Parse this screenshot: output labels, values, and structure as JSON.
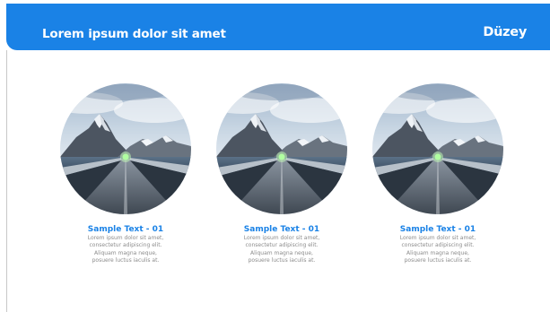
{
  "header": {
    "title": "Lorem ipsum dolor sit amet",
    "brand": "Düzey"
  },
  "cards": [
    {
      "photo_icon": "mountain-road-photo",
      "heading": "Sample Text - 01",
      "body_lines": [
        "Lorem ipsum dolor sit amet,",
        "consectetur adipiscing elit.",
        "Aliquam magna neque,",
        "posuere luctus iaculis at."
      ]
    },
    {
      "photo_icon": "mountain-road-photo",
      "heading": "Sample Text - 01",
      "body_lines": [
        "Lorem ipsum dolor sit amet,",
        "consectetur adipiscing elit.",
        "Aliquam magna neque,",
        "posuere luctus iaculis at."
      ]
    },
    {
      "photo_icon": "mountain-road-photo",
      "heading": "Sample Text - 01",
      "body_lines": [
        "Lorem ipsum dolor sit amet,",
        "consectetur adipiscing elit.",
        "Aliquam magna neque,",
        "posuere luctus iaculis at."
      ]
    }
  ],
  "colors": {
    "accent": "#1a82e6",
    "header_text": "#ffffff",
    "body_text": "#8c8c8c"
  }
}
